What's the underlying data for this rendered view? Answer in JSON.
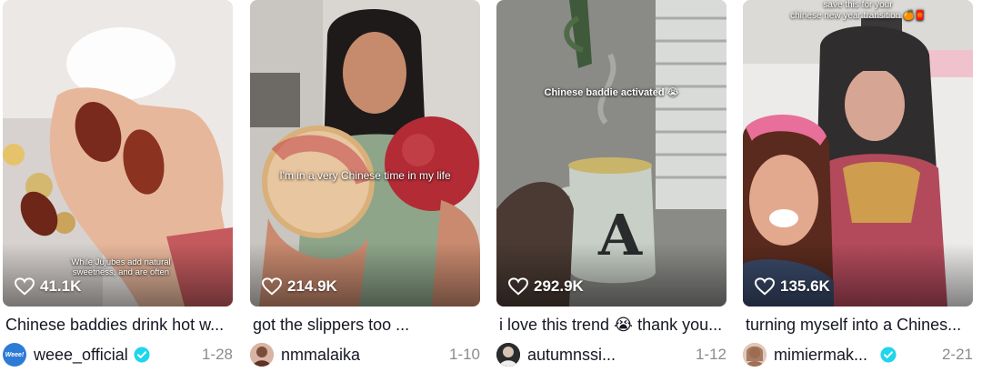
{
  "colors": {
    "verified_badge": "#20d5ec",
    "date_text": "#8a8b91",
    "title_text": "#161823",
    "likes_text": "#ffffff"
  },
  "videos": [
    {
      "overlay_text": "While Jujubes add natural sweetness, and are often",
      "likes": "41.1K",
      "title": "Chinese baddies drink hot w...",
      "username": "weee_official",
      "avatar_text": "Weee!",
      "verified": true,
      "date": "1-28"
    },
    {
      "overlay_text": "I'm in a very Chinese time in my life",
      "likes": "214.9K",
      "title": "got the slippers too ...",
      "username": "nmmalaika",
      "verified": false,
      "date": "1-10"
    },
    {
      "overlay_text": "Chinese baddie activated 😭",
      "likes": "292.9K",
      "title": "i love this trend 😭 thank you...",
      "username": "autumnssi...",
      "verified": false,
      "date": "1-12"
    },
    {
      "overlay_text_line1": "save this for your",
      "overlay_text_line2": "chinese new year transition 🍊🧧",
      "likes": "135.6K",
      "title": "turning myself into a Chines...",
      "username": "mimiermak...",
      "verified": true,
      "date": "2-21"
    }
  ]
}
